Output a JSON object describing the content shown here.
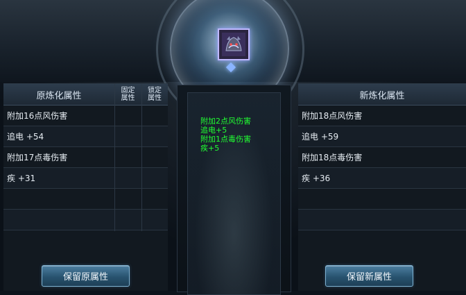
{
  "left_panel": {
    "header": "原炼化属性",
    "fixed_col": [
      "固定",
      "属性"
    ],
    "lock_col": [
      "锁定",
      "属性"
    ],
    "rows": [
      "附加16点风伤害",
      "追电 +54",
      "附加17点毒伤害",
      "疾 +31",
      "",
      ""
    ]
  },
  "right_panel": {
    "header": "新炼化属性",
    "rows": [
      "附加18点风伤害",
      "追电 +59",
      "附加18点毒伤害",
      "疾 +36",
      "",
      ""
    ]
  },
  "center": {
    "bonuses": [
      "附加2点风伤害",
      "追电+5",
      "附加1点毒伤害",
      "疾+5"
    ]
  },
  "buttons": {
    "keep_original": "保留原属性",
    "keep_new": "保留新属性"
  },
  "colors": {
    "bonus_text": "#21ff32",
    "header_text": "#dbe6f2"
  },
  "icons": {
    "item": "dragon-helmet-icon"
  }
}
